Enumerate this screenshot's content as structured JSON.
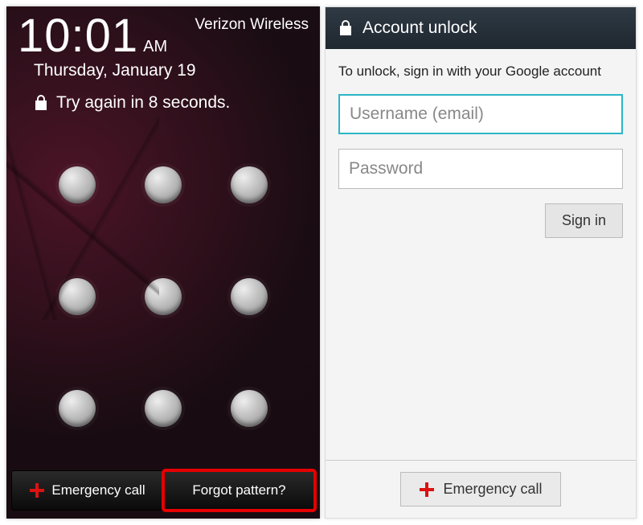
{
  "lockscreen": {
    "time": "10:01",
    "ampm": "AM",
    "carrier": "Verizon Wireless",
    "date": "Thursday, January 19",
    "lock_message": "Try again in 8 seconds.",
    "emergency_label": "Emergency call",
    "forgot_label": "Forgot pattern?"
  },
  "unlock": {
    "title": "Account unlock",
    "instruction": "To unlock, sign in with your Google account",
    "username_placeholder": "Username (email)",
    "password_placeholder": "Password",
    "signin_label": "Sign in",
    "emergency_label": "Emergency call"
  },
  "colors": {
    "highlight": "#e60000",
    "focus_border": "#2bb6c7"
  }
}
